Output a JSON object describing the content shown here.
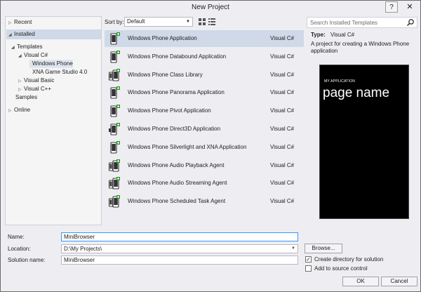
{
  "window": {
    "title": "New Project",
    "help": "?",
    "close": "✕"
  },
  "tree": {
    "recent": "Recent",
    "installed": "Installed",
    "templates": "Templates",
    "visual_csharp": "Visual C#",
    "windows_phone": "Windows Phone",
    "xna": "XNA Game Studio 4.0",
    "visual_basic": "Visual Basic",
    "visual_cpp": "Visual C++",
    "samples": "Samples",
    "online": "Online"
  },
  "toolbar": {
    "sort_label": "Sort by:",
    "sort_value": "Default"
  },
  "templates": [
    {
      "name": "Windows Phone Application",
      "lang": "Visual C#",
      "icon": "phone-app-icon",
      "selected": true
    },
    {
      "name": "Windows Phone Databound Application",
      "lang": "Visual C#",
      "icon": "phone-databound-icon"
    },
    {
      "name": "Windows Phone Class Library",
      "lang": "Visual C#",
      "icon": "phone-class-library-icon"
    },
    {
      "name": "Windows Phone Panorama Application",
      "lang": "Visual C#",
      "icon": "phone-panorama-icon"
    },
    {
      "name": "Windows Phone Pivot Application",
      "lang": "Visual C#",
      "icon": "phone-pivot-icon"
    },
    {
      "name": "Windows Phone Direct3D Application",
      "lang": "Visual C#",
      "icon": "phone-direct3d-icon"
    },
    {
      "name": "Windows Phone Silverlight and XNA Application",
      "lang": "Visual C#",
      "icon": "phone-silverlight-xna-icon"
    },
    {
      "name": "Windows Phone Audio Playback Agent",
      "lang": "Visual C#",
      "icon": "phone-audio-playback-icon"
    },
    {
      "name": "Windows Phone Audio Streaming Agent",
      "lang": "Visual C#",
      "icon": "phone-audio-streaming-icon"
    },
    {
      "name": "Windows Phone Scheduled Task Agent",
      "lang": "Visual C#",
      "icon": "phone-scheduled-task-icon"
    }
  ],
  "details": {
    "search_placeholder": "Search Installed Templates",
    "type_label": "Type:",
    "type_value": "Visual C#",
    "description": "A project for creating a Windows Phone application",
    "preview_app_title": "MY APPLICATION",
    "preview_page_name": "page name"
  },
  "form": {
    "name_label": "Name:",
    "name_value": "MiniBrowser",
    "location_label": "Location:",
    "location_value": "D:\\My Projects\\",
    "solution_label": "Solution name:",
    "solution_value": "MiniBrowser",
    "browse": "Browse...",
    "create_dir": "Create directory for solution",
    "create_dir_checked": true,
    "add_source": "Add to source control",
    "add_source_checked": false,
    "ok": "OK",
    "cancel": "Cancel"
  }
}
